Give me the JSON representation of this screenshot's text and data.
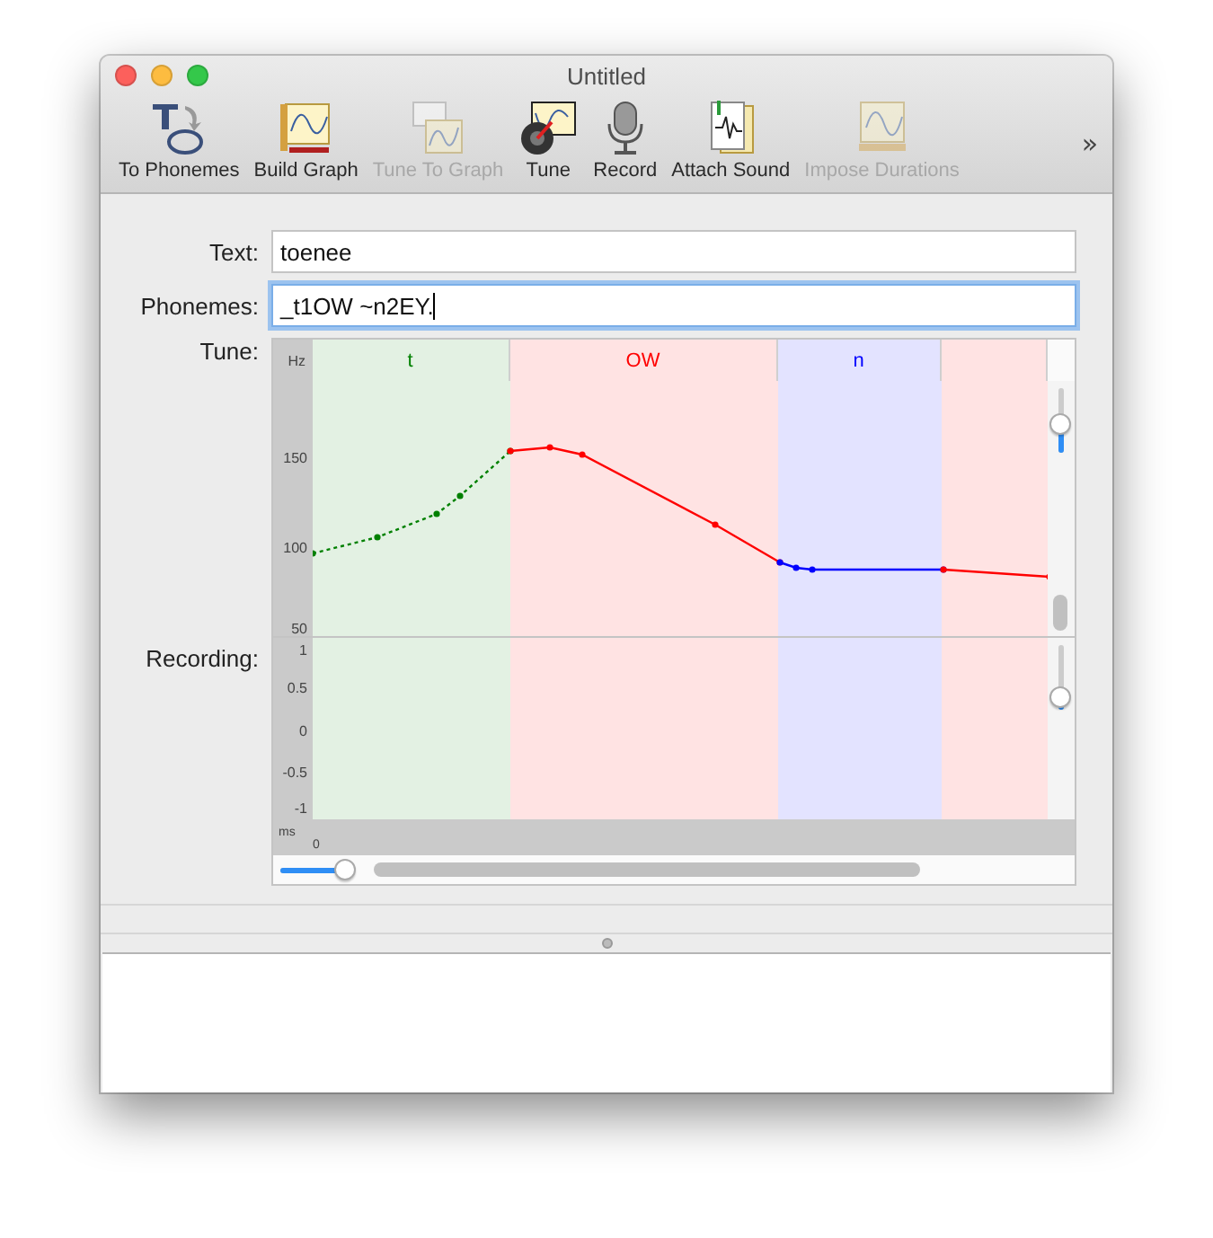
{
  "window": {
    "title": "Untitled"
  },
  "toolbar": [
    {
      "label": "To Phonemes",
      "disabled": false
    },
    {
      "label": "Build Graph",
      "disabled": false
    },
    {
      "label": "Tune To Graph",
      "disabled": true
    },
    {
      "label": "Tune",
      "disabled": false
    },
    {
      "label": "Record",
      "disabled": false
    },
    {
      "label": "Attach Sound",
      "disabled": false
    },
    {
      "label": "Impose Durations",
      "disabled": true
    }
  ],
  "toolbar_overflow": "»",
  "fields": [
    {
      "label": "Text:",
      "value": "toenee",
      "focused": false
    },
    {
      "label": "Phonemes:",
      "value": "_t1OW ~n2EY.",
      "focused": true
    }
  ],
  "tune": {
    "label": "Tune:",
    "unit": "Hz",
    "ticks": [
      "150",
      "100",
      "50"
    ],
    "segments": [
      {
        "label": "t",
        "color": "#008000"
      },
      {
        "label": "OW",
        "color": "#ff0000"
      },
      {
        "label": "n",
        "color": "#0000ff"
      },
      {
        "color": "#ff0000"
      }
    ],
    "zoom_slider": {
      "level": 0.45
    }
  },
  "recording": {
    "label": "Recording:",
    "ticks": [
      "1",
      "0.5",
      "0",
      "-0.5",
      "-1"
    ],
    "zoom_slider": {
      "level": 0.2
    }
  },
  "time_axis": {
    "unit": "ms",
    "origin": "0"
  },
  "time_zoom_slider": {
    "level": 0.9
  }
}
